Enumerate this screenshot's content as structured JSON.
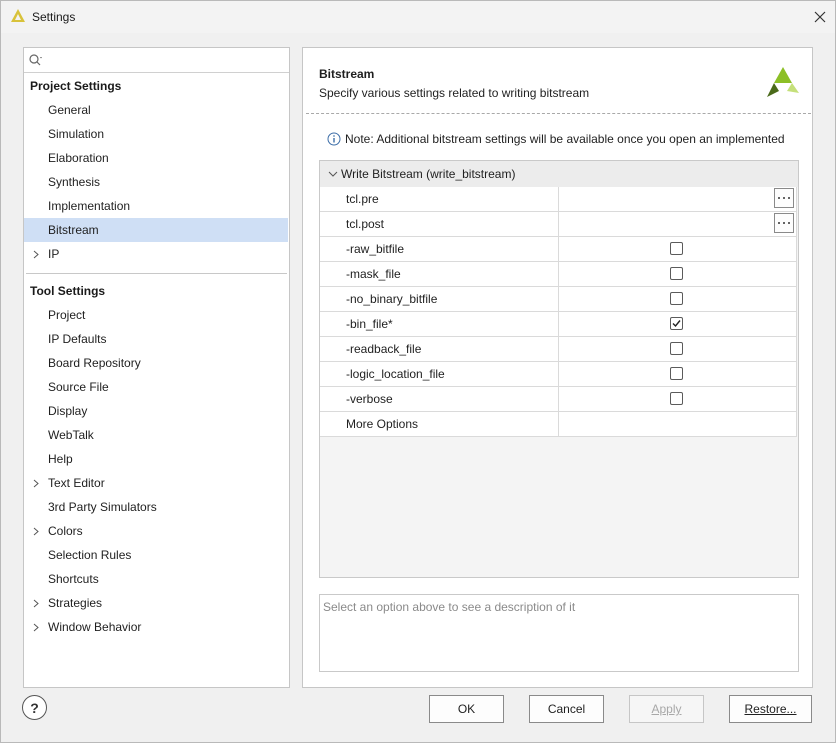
{
  "window": {
    "title": "Settings"
  },
  "search": {
    "placeholder": "",
    "value": ""
  },
  "project_settings": {
    "header": "Project Settings",
    "items": [
      {
        "label": "General",
        "expandable": false,
        "selected": false
      },
      {
        "label": "Simulation",
        "expandable": false,
        "selected": false
      },
      {
        "label": "Elaboration",
        "expandable": false,
        "selected": false
      },
      {
        "label": "Synthesis",
        "expandable": false,
        "selected": false
      },
      {
        "label": "Implementation",
        "expandable": false,
        "selected": false
      },
      {
        "label": "Bitstream",
        "expandable": false,
        "selected": true
      },
      {
        "label": "IP",
        "expandable": true,
        "selected": false
      }
    ]
  },
  "tool_settings": {
    "header": "Tool Settings",
    "items": [
      {
        "label": "Project",
        "expandable": false
      },
      {
        "label": "IP Defaults",
        "expandable": false
      },
      {
        "label": "Board Repository",
        "expandable": false
      },
      {
        "label": "Source File",
        "expandable": false
      },
      {
        "label": "Display",
        "expandable": false
      },
      {
        "label": "WebTalk",
        "expandable": false
      },
      {
        "label": "Help",
        "expandable": false
      },
      {
        "label": "Text Editor",
        "expandable": true
      },
      {
        "label": "3rd Party Simulators",
        "expandable": false
      },
      {
        "label": "Colors",
        "expandable": true
      },
      {
        "label": "Selection Rules",
        "expandable": false
      },
      {
        "label": "Shortcuts",
        "expandable": false
      },
      {
        "label": "Strategies",
        "expandable": true
      },
      {
        "label": "Window Behavior",
        "expandable": true
      }
    ]
  },
  "panel": {
    "title": "Bitstream",
    "subtitle": "Specify various settings related to writing bitstream",
    "note": "Note: Additional bitstream settings will be available once you open an implemented"
  },
  "table": {
    "group_label": "Write Bitstream (write_bitstream)",
    "rows": [
      {
        "name": "tcl.pre",
        "type": "file"
      },
      {
        "name": "tcl.post",
        "type": "file"
      },
      {
        "name": "-raw_bitfile",
        "type": "checkbox",
        "checked": false
      },
      {
        "name": "-mask_file",
        "type": "checkbox",
        "checked": false
      },
      {
        "name": "-no_binary_bitfile",
        "type": "checkbox",
        "checked": false
      },
      {
        "name": "-bin_file*",
        "type": "checkbox",
        "checked": true
      },
      {
        "name": "-readback_file",
        "type": "checkbox",
        "checked": false
      },
      {
        "name": "-logic_location_file",
        "type": "checkbox",
        "checked": false
      },
      {
        "name": "-verbose",
        "type": "checkbox",
        "checked": false
      },
      {
        "name": "More Options",
        "type": "text"
      }
    ]
  },
  "description": {
    "placeholder": "Select an option above to see a description of it"
  },
  "footer": {
    "help_label": "?",
    "ok_label": "OK",
    "cancel_label": "Cancel",
    "apply_label": "Apply",
    "restore_label": "Restore..."
  },
  "colors": {
    "selection": "#cfdff5",
    "logo_green": "#8cbf26",
    "logo_dark": "#4a6a1a"
  },
  "icons": {
    "search": "search-icon",
    "close": "close-icon",
    "info": "info-icon",
    "chevron_right": "chevron-right-icon",
    "chevron_down": "chevron-down-icon",
    "ellipsis": "ellipsis-icon",
    "check": "check-icon"
  }
}
